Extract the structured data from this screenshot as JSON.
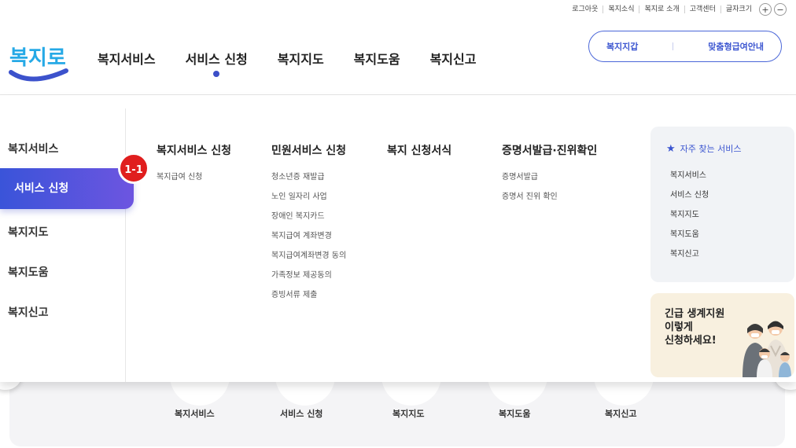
{
  "utility": {
    "logout": "로그아웃",
    "news": "복지소식",
    "about": "복지로 소개",
    "customer_center": "고객센터",
    "font_size": "글자크기",
    "plus": "+",
    "minus": "−"
  },
  "logo": {
    "text": "복지로"
  },
  "gnb": {
    "items": [
      "복지서비스",
      "서비스 신청",
      "복지지도",
      "복지도움",
      "복지신고"
    ],
    "active_index": 1
  },
  "pill": {
    "wallet": "복지지갑",
    "guide": "맞춤형급여안내"
  },
  "lnb": {
    "items": [
      "복지서비스",
      "서비스 신청",
      "복지지도",
      "복지도움",
      "복지신고"
    ],
    "active": "서비스 신청"
  },
  "badge": "1-1",
  "columns": [
    {
      "title": "복지서비스 신청",
      "links": [
        "복지급여 신청"
      ]
    },
    {
      "title": "민원서비스 신청",
      "links": [
        "청소년증 재발급",
        "노인 일자리 사업",
        "장애인 복지카드",
        "복지급여 계좌변경",
        "복지급여계좌변경 동의",
        "가족정보 제공동의",
        "증빙서류 제출"
      ]
    },
    {
      "title": "복지 신청서식",
      "links": []
    },
    {
      "title": "증명서발급·진위확인",
      "links": [
        "증명서발급",
        "증명서 진위 확인"
      ]
    }
  ],
  "favorites": {
    "title": "자주 찾는 서비스",
    "items": [
      "복지서비스",
      "서비스 신청",
      "복지지도",
      "복지도움",
      "복지신고"
    ]
  },
  "emergency": {
    "line1": "긴급 생계지원",
    "line2": "이렇게",
    "line3": "신청하세요!"
  },
  "quick": {
    "items": [
      "복지서비스",
      "서비스 신청",
      "복지지도",
      "복지도움",
      "복지신고"
    ]
  },
  "colors": {
    "accent": "#3b55d0",
    "badge": "#e01e1e",
    "emergency_bg": "#f8f0df"
  }
}
